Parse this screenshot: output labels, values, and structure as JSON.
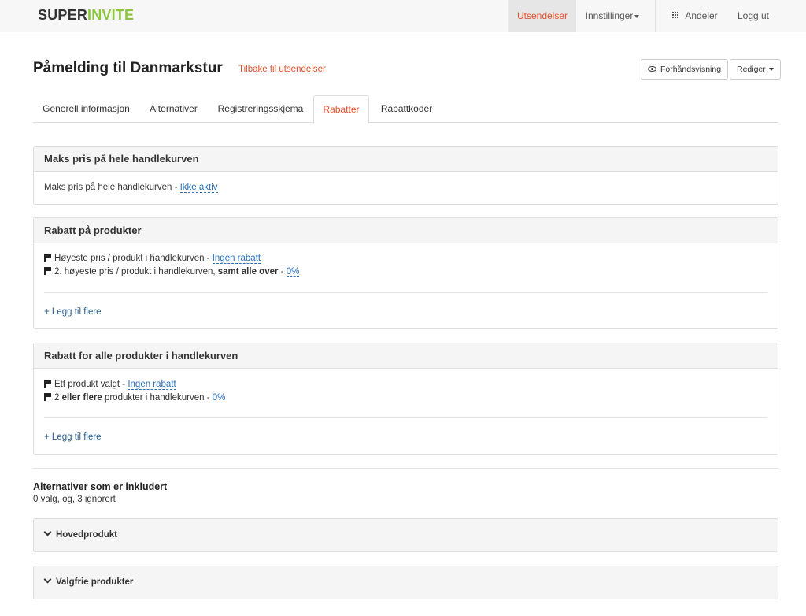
{
  "navbar": {
    "logo_part1": "SUPER",
    "logo_part2": "INVITE",
    "utsendelser": "Utsendelser",
    "innstillinger": "Innstillinger",
    "andeler": "Andeler",
    "logg_ut": "Logg ut"
  },
  "header": {
    "title": "Påmelding til Danmarkstur",
    "back_link": "Tilbake til utsendelser",
    "preview_button": "Forhåndsvisning",
    "edit_button": "Rediger"
  },
  "tabs": [
    {
      "label": "Generell informasjon"
    },
    {
      "label": "Alternativer"
    },
    {
      "label": "Registreringsskjema"
    },
    {
      "label": "Rabatter"
    },
    {
      "label": "Rabattkoder"
    }
  ],
  "active_tab": "Rabatter",
  "panel_max": {
    "heading": "Maks pris på hele handlekurven",
    "row_text": "Maks pris på hele handlekurven - ",
    "row_link": "Ikke aktiv"
  },
  "panel_products": {
    "heading": "Rabatt på produkter",
    "row1_text": "Høyeste pris / produkt i handlekurven - ",
    "row1_link": "Ingen rabatt",
    "row2_text": "2. høyeste pris / produkt i handlekurven, ",
    "row2_bold": "samt alle over",
    "row2_sep": " - ",
    "row2_link": "0%",
    "add_link": "+ Legg til flere"
  },
  "panel_all": {
    "heading": "Rabatt for alle produkter i handlekurven",
    "row1_text": "Ett produkt valgt - ",
    "row1_link": "Ingen rabatt",
    "row2_pre": "2 ",
    "row2_bold": "eller flere",
    "row2_text": " produkter i handlekurven - ",
    "row2_link": "0%",
    "add_link": "+ Legg til flere"
  },
  "included": {
    "title": "Alternativer som er inkludert",
    "subtitle": "0 valg, og, 3 ignorert"
  },
  "collapsibles": [
    {
      "label": "Hovedprodukt"
    },
    {
      "label": "Valgfrie produkter"
    }
  ]
}
